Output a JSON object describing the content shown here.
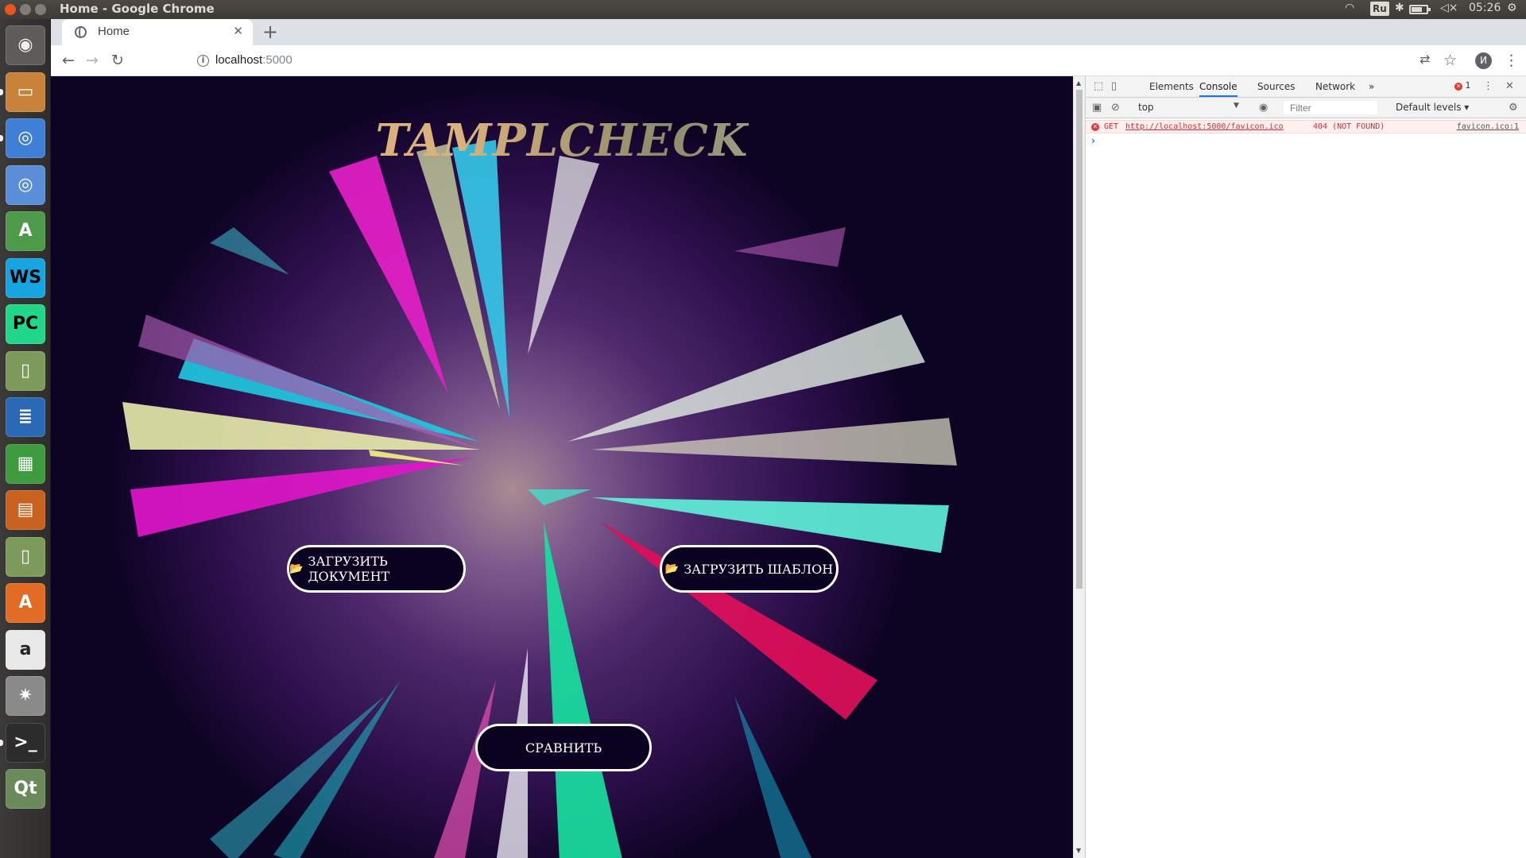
{
  "window": {
    "title": "Home - Google Chrome"
  },
  "tray": {
    "clock": "05:26",
    "language": "Ru",
    "battery_level": 0.7
  },
  "launcher": {
    "items": [
      {
        "name": "dash-icon",
        "glyph": "◉",
        "bg": "#5e5c58",
        "fg": "#f0f0f0"
      },
      {
        "name": "files-icon",
        "glyph": "▭",
        "bg": "#c9823a",
        "fg": "#ffffff"
      },
      {
        "name": "chrome-icon",
        "glyph": "◎",
        "bg": "#3f7fd6",
        "fg": "#ffffff"
      },
      {
        "name": "chromium-icon",
        "glyph": "◎",
        "bg": "#5b8ed8",
        "fg": "#ffffff"
      },
      {
        "name": "android-studio-icon",
        "glyph": "A",
        "bg": "#4c9a4a",
        "fg": "#ffffff"
      },
      {
        "name": "webstorm-icon",
        "glyph": "WS",
        "bg": "#16a5e0",
        "fg": "#000000"
      },
      {
        "name": "pycharm-icon",
        "glyph": "PC",
        "bg": "#21d789",
        "fg": "#000000"
      },
      {
        "name": "app-icon",
        "glyph": "▯",
        "bg": "#7c9a5a",
        "fg": "#ffffff"
      },
      {
        "name": "writer-icon",
        "glyph": "≣",
        "bg": "#2a6ab5",
        "fg": "#ffffff"
      },
      {
        "name": "calc-icon",
        "glyph": "▦",
        "bg": "#3e9b3e",
        "fg": "#ffffff"
      },
      {
        "name": "impress-icon",
        "glyph": "▤",
        "bg": "#c9621f",
        "fg": "#ffffff"
      },
      {
        "name": "app-icon-2",
        "glyph": "▯",
        "bg": "#7c9a5a",
        "fg": "#ffffff"
      },
      {
        "name": "software-center-icon",
        "glyph": "A",
        "bg": "#e26c23",
        "fg": "#ffffff"
      },
      {
        "name": "amazon-icon",
        "glyph": "a",
        "bg": "#e8e8e8",
        "fg": "#222222"
      },
      {
        "name": "settings-icon",
        "glyph": "✷",
        "bg": "#8a8a8a",
        "fg": "#ffffff"
      },
      {
        "name": "terminal-icon",
        "glyph": ">_",
        "bg": "#2c2c2c",
        "fg": "#ffffff"
      },
      {
        "name": "qt-icon",
        "glyph": "Qt",
        "bg": "#6a8a5a",
        "fg": "#ffffff"
      }
    ]
  },
  "browser": {
    "tab_title": "Home",
    "url_host": "localhost",
    "url_port": ":5000"
  },
  "page": {
    "title": "TAMPLCHECK",
    "upload_document": "ЗАГРУЗИТЬ ДОКУМЕНТ",
    "upload_template": "ЗАГРУЗИТЬ ШАБЛОН",
    "compare": "СРАВНИТЬ"
  },
  "devtools": {
    "tabs": [
      "Elements",
      "Console",
      "Sources",
      "Network"
    ],
    "active_tab": "Console",
    "error_count": "1",
    "context": "top",
    "filter_placeholder": "Filter",
    "levels": "Default levels ▾",
    "log": {
      "method": "GET",
      "url": "http://localhost:5000/favicon.ico",
      "status": "404 (NOT FOUND)",
      "source": "favicon.ico:1"
    }
  }
}
